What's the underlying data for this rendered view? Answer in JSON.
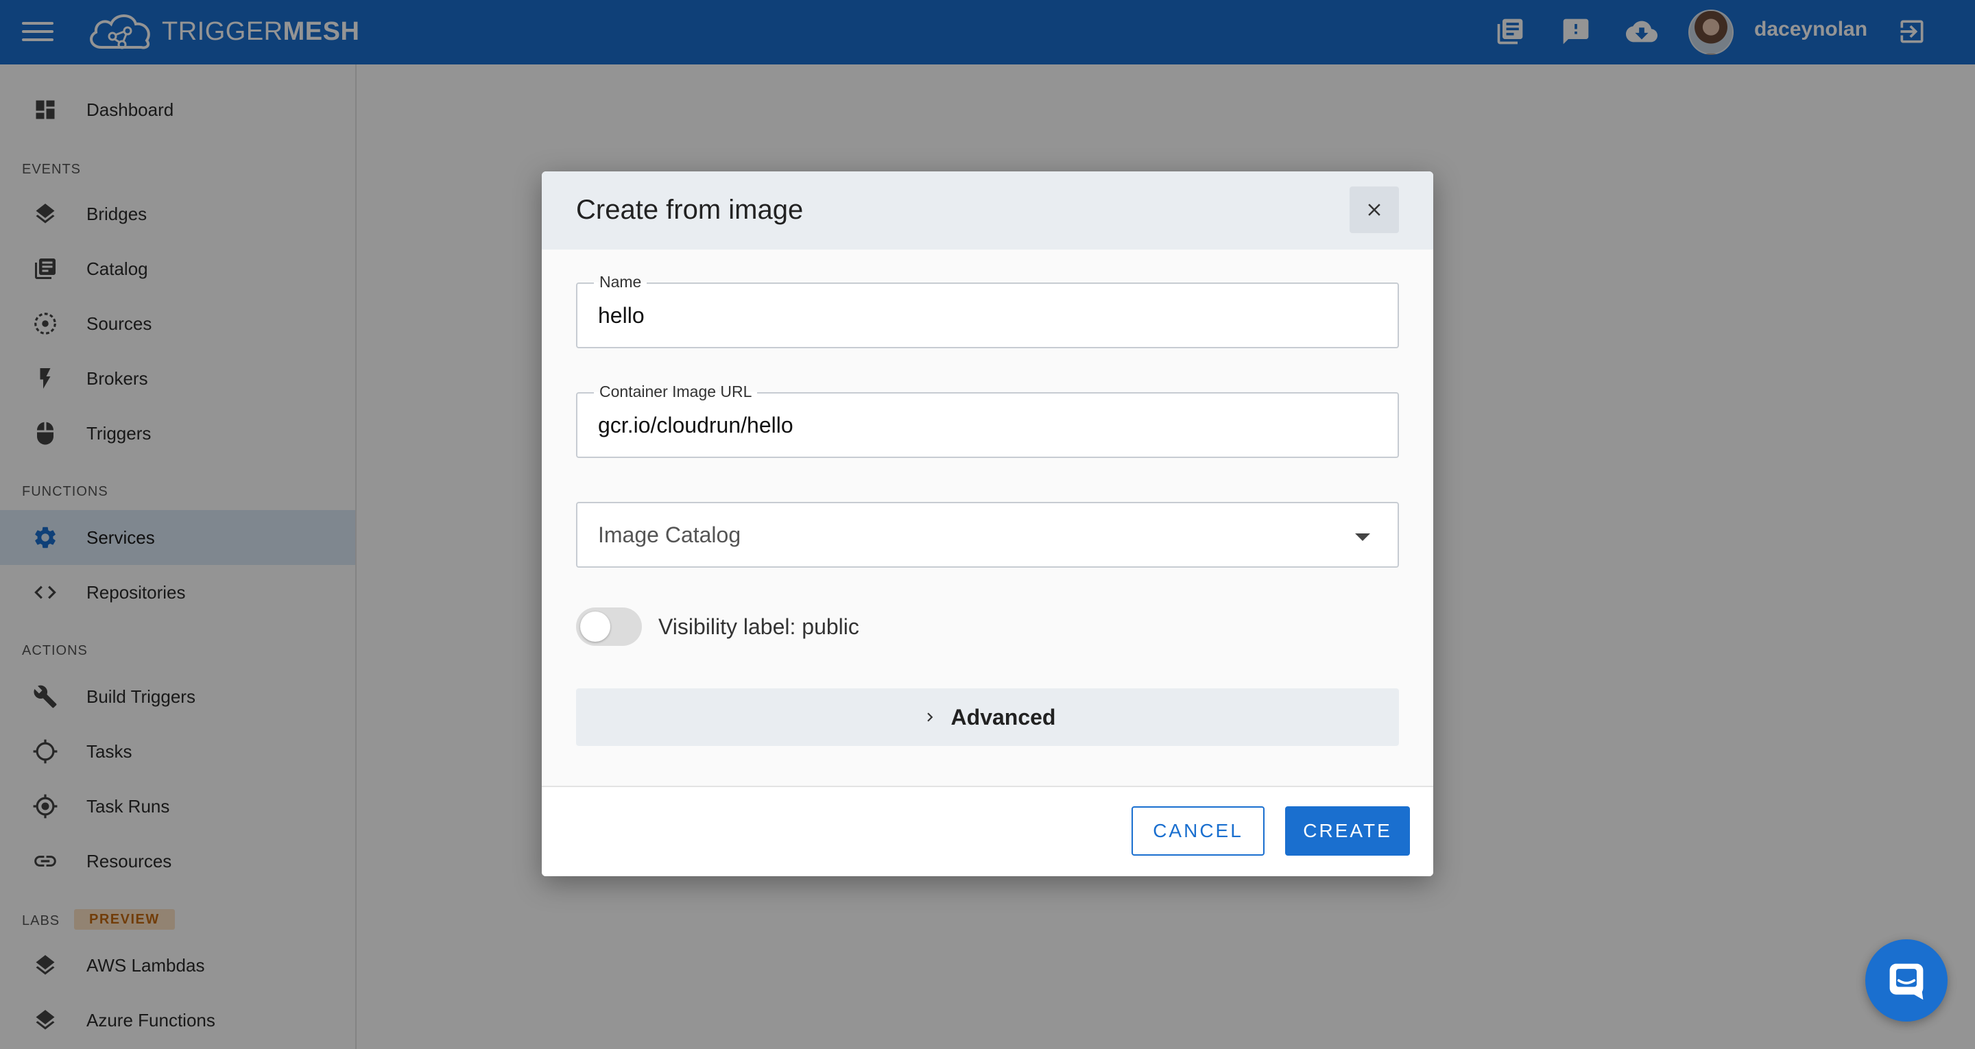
{
  "app": {
    "brand_light": "TRIGGER",
    "brand_bold": "MESH",
    "username": "daceynolan",
    "accent_color": "#1a6fcf"
  },
  "topbar_icons": [
    "menu-icon",
    "docs-icon",
    "feedback-icon",
    "download-icon",
    "logout-icon"
  ],
  "sidebar": {
    "top_item": {
      "label": "Dashboard",
      "icon": "dashboard-icon"
    },
    "sections": [
      {
        "title": "EVENTS",
        "items": [
          {
            "label": "Bridges",
            "icon": "layers-icon"
          },
          {
            "label": "Catalog",
            "icon": "catalog-icon"
          },
          {
            "label": "Sources",
            "icon": "sources-icon"
          },
          {
            "label": "Brokers",
            "icon": "bolt-icon"
          },
          {
            "label": "Triggers",
            "icon": "mouse-icon"
          }
        ]
      },
      {
        "title": "FUNCTIONS",
        "items": [
          {
            "label": "Services",
            "icon": "gear-icon",
            "active": true
          },
          {
            "label": "Repositories",
            "icon": "code-icon"
          }
        ]
      },
      {
        "title": "ACTIONS",
        "items": [
          {
            "label": "Build Triggers",
            "icon": "wrench-icon"
          },
          {
            "label": "Tasks",
            "icon": "crosshair-icon"
          },
          {
            "label": "Task Runs",
            "icon": "target-icon"
          },
          {
            "label": "Resources",
            "icon": "link-icon"
          }
        ]
      },
      {
        "title": "LABS",
        "badge": "PREVIEW",
        "items": [
          {
            "label": "AWS Lambdas",
            "icon": "layers-icon"
          },
          {
            "label": "Azure Functions",
            "icon": "layers-icon"
          }
        ]
      }
    ]
  },
  "dialog": {
    "title": "Create from image",
    "name_field": {
      "label": "Name",
      "value": "hello"
    },
    "image_url_field": {
      "label": "Container Image URL",
      "value": "gcr.io/cloudrun/hello"
    },
    "image_catalog": {
      "placeholder": "Image Catalog"
    },
    "visibility_toggle": {
      "label": "Visibility label: public",
      "on": false
    },
    "advanced_label": "Advanced",
    "cancel_label": "CANCEL",
    "create_label": "CREATE"
  }
}
